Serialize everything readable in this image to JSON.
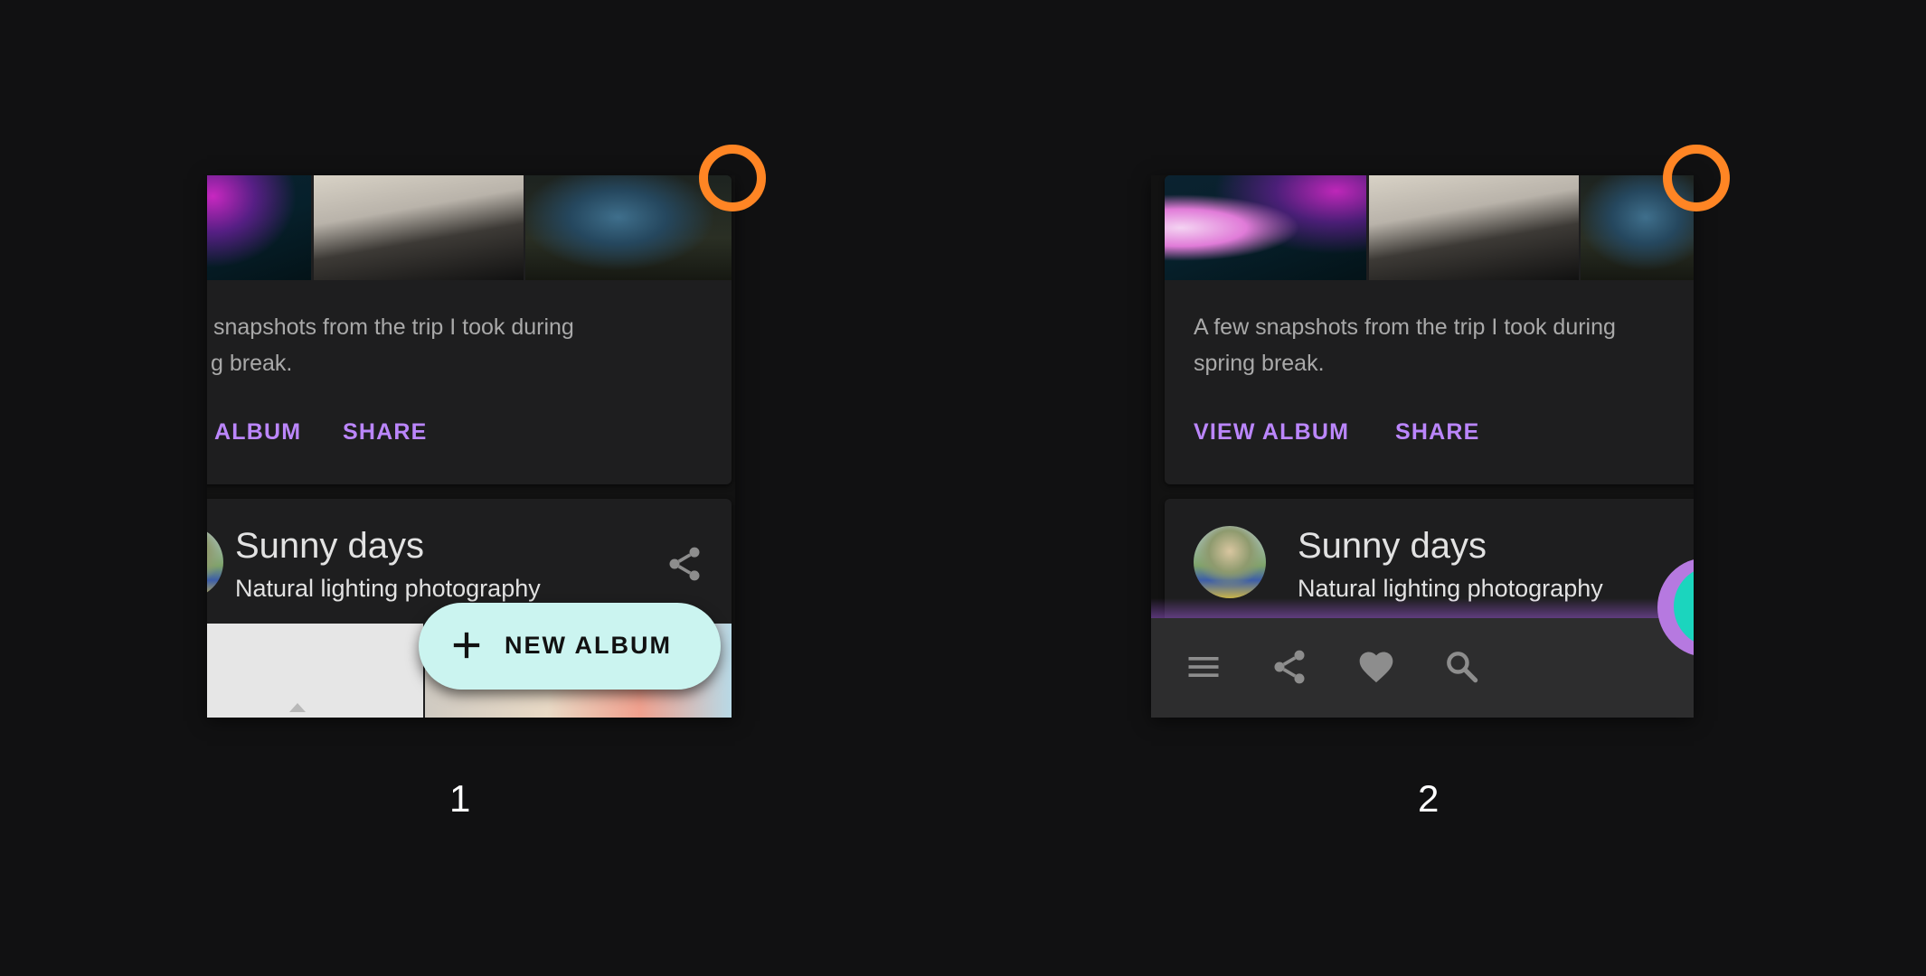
{
  "frames": [
    {
      "caption": "1",
      "card_text": "A few snapshots from the trip I took during spring break.",
      "card_text_visible_line1": "snapshots from the trip I took during",
      "card_text_visible_line2": "g break.",
      "view_album_label": "ALBUM",
      "share_label": "SHARE",
      "card2_title": "Sunny days",
      "card2_subtitle": "Natural lighting photography",
      "fab_label": "NEW ALBUM"
    },
    {
      "caption": "2",
      "card_text_line1": "A few snapshots from the trip I took during",
      "card_text_line2": "spring break.",
      "view_album_label": "VIEW ALBUM",
      "share_label": "SHARE",
      "card2_title": "Sunny days",
      "card2_subtitle": "Natural lighting photography",
      "bottom_bar_icons": [
        "menu-icon",
        "share-icon",
        "heart-icon",
        "search-icon"
      ]
    }
  ],
  "colors": {
    "background": "#111112",
    "card": "#1e1e1f",
    "accent_purple": "#bb86fc",
    "fab": "#cbf4f0",
    "focus_ring": "#ff8524",
    "bottom_bar": "#2d2d2e"
  }
}
